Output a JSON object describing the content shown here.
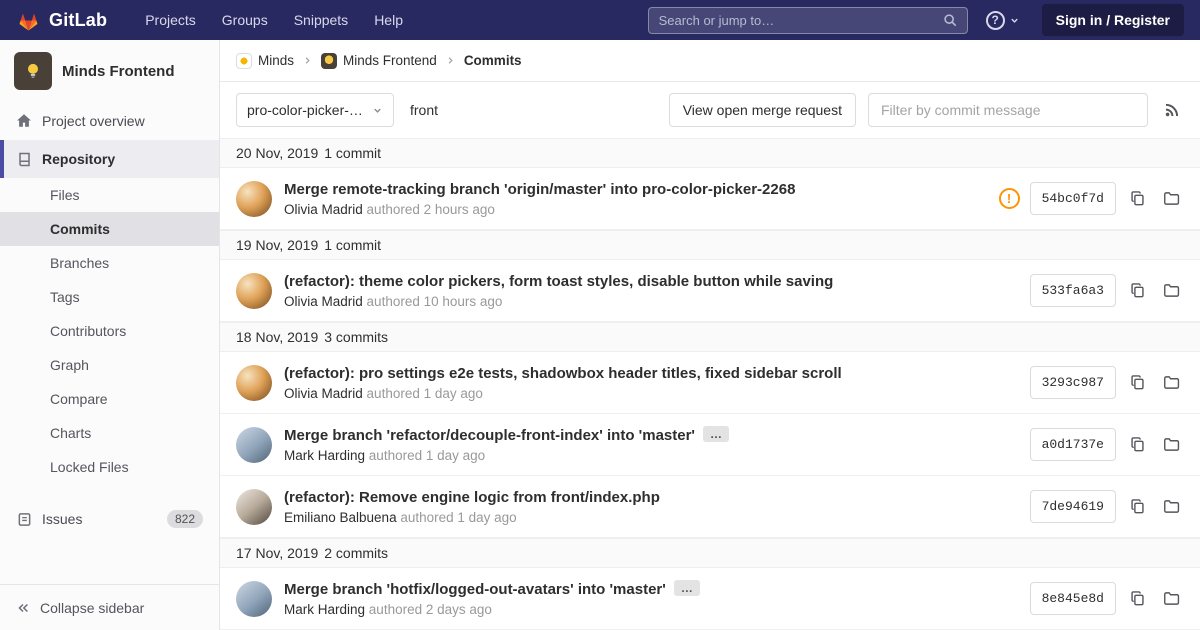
{
  "navbar": {
    "brand": "GitLab",
    "menu": [
      {
        "label": "Projects"
      },
      {
        "label": "Groups"
      },
      {
        "label": "Snippets"
      },
      {
        "label": "Help"
      }
    ],
    "search_placeholder": "Search or jump to…",
    "help_glyph": "?",
    "sign_in_label": "Sign in / Register"
  },
  "sidebar": {
    "project_name": "Minds Frontend",
    "overview_label": "Project overview",
    "repository_label": "Repository",
    "repo_items": [
      {
        "label": "Files"
      },
      {
        "label": "Commits"
      },
      {
        "label": "Branches"
      },
      {
        "label": "Tags"
      },
      {
        "label": "Contributors"
      },
      {
        "label": "Graph"
      },
      {
        "label": "Compare"
      },
      {
        "label": "Charts"
      },
      {
        "label": "Locked Files"
      }
    ],
    "issues_label": "Issues",
    "issues_count": "822",
    "collapse_label": "Collapse sidebar"
  },
  "breadcrumb": {
    "group": "Minds",
    "project": "Minds Frontend",
    "page": "Commits"
  },
  "controls": {
    "branch_selector": "pro-color-picker-…",
    "ref_path": "front",
    "merge_request_button": "View open merge request",
    "filter_placeholder": "Filter by commit message"
  },
  "icons": {
    "expand_glyph": "…",
    "warning_glyph": "!"
  },
  "commits": {
    "groups": [
      {
        "date": "20 Nov, 2019",
        "count": "1 commit",
        "items": [
          {
            "title": "Merge remote-tracking branch 'origin/master' into pro-color-picker-2268",
            "author": "Olivia Madrid",
            "authored": "authored 2 hours ago",
            "sha": "54bc0f7d"
          }
        ]
      },
      {
        "date": "19 Nov, 2019",
        "count": "1 commit",
        "items": [
          {
            "title": "(refactor): theme color pickers, form toast styles, disable button while saving",
            "author": "Olivia Madrid",
            "authored": "authored 10 hours ago",
            "sha": "533fa6a3"
          }
        ]
      },
      {
        "date": "18 Nov, 2019",
        "count": "3 commits",
        "items": [
          {
            "title": "(refactor): pro settings e2e tests, shadowbox header titles, fixed sidebar scroll",
            "author": "Olivia Madrid",
            "authored": "authored 1 day ago",
            "sha": "3293c987"
          },
          {
            "title": "Merge branch 'refactor/decouple-front-index' into 'master'",
            "author": "Mark Harding",
            "authored": "authored 1 day ago",
            "sha": "a0d1737e"
          },
          {
            "title": "(refactor): Remove engine logic from front/index.php",
            "author": "Emiliano Balbuena",
            "authored": "authored 1 day ago",
            "sha": "7de94619"
          }
        ]
      },
      {
        "date": "17 Nov, 2019",
        "count": "2 commits",
        "items": [
          {
            "title": "Merge branch 'hotfix/logged-out-avatars' into 'master'",
            "author": "Mark Harding",
            "authored": "authored 2 days ago",
            "sha": "8e845e8d"
          }
        ]
      }
    ]
  }
}
